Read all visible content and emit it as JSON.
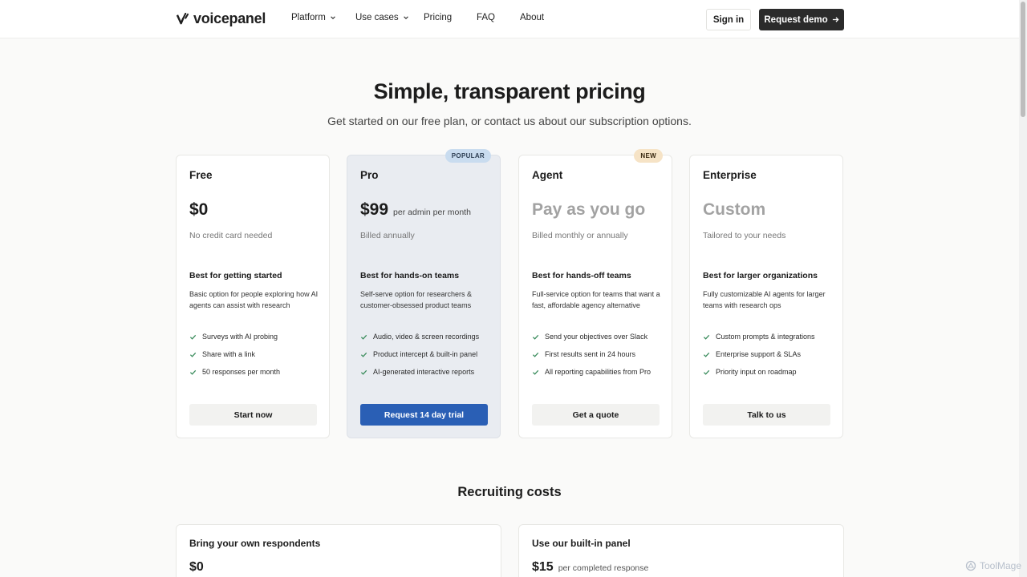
{
  "nav": {
    "logo_text": "voicepanel",
    "items": [
      {
        "label": "Platform",
        "has_dropdown": true
      },
      {
        "label": "Use cases",
        "has_dropdown": true
      },
      {
        "label": "Pricing",
        "has_dropdown": false
      },
      {
        "label": "FAQ",
        "has_dropdown": false
      },
      {
        "label": "About",
        "has_dropdown": false
      }
    ],
    "sign_in": "Sign in",
    "request_demo": "Request demo"
  },
  "hero": {
    "title": "Simple, transparent pricing",
    "subtitle": "Get started on our free plan, or contact us about our subscription options."
  },
  "plans": [
    {
      "name": "Free",
      "badge": "",
      "price": "$0",
      "price_unit": "",
      "billing": "No credit card needed",
      "best_for": "Best for getting started",
      "description": "Basic option for people exploring how AI agents can assist with research",
      "features": [
        "Surveys with AI probing",
        "Share with a link",
        "50 responses per month"
      ],
      "cta": "Start now"
    },
    {
      "name": "Pro",
      "badge": "POPULAR",
      "price": "$99",
      "price_unit": "per admin per month",
      "billing": "Billed annually",
      "best_for": "Best for hands-on teams",
      "description": "Self-serve option for researchers & customer-obsessed product teams",
      "features": [
        "Audio, video & screen recordings",
        "Product intercept & built-in panel",
        "AI-generated interactive reports"
      ],
      "cta": "Request 14 day trial"
    },
    {
      "name": "Agent",
      "badge": "NEW",
      "price": "Pay as you go",
      "price_unit": "",
      "billing": "Billed monthly or annually",
      "best_for": "Best for hands-off teams",
      "description": "Full-service option for teams that want a fast, affordable agency alternative",
      "features": [
        "Send your objectives over Slack",
        "First results sent in 24 hours",
        "All reporting capabilities from Pro"
      ],
      "cta": "Get a quote"
    },
    {
      "name": "Enterprise",
      "badge": "",
      "price": "Custom",
      "price_unit": "",
      "billing": "Tailored to your needs",
      "best_for": "Best for larger organizations",
      "description": "Fully customizable AI agents for larger teams with research ops",
      "features": [
        "Custom prompts & integrations",
        "Enterprise support & SLAs",
        "Priority input on roadmap"
      ],
      "cta": "Talk to us"
    }
  ],
  "recruiting": {
    "title": "Recruiting costs",
    "options": [
      {
        "name": "Bring your own respondents",
        "price": "$0",
        "unit": ""
      },
      {
        "name": "Use our built-in panel",
        "price": "$15",
        "unit": "per completed response"
      }
    ]
  },
  "watermark": "ToolMage",
  "colors": {
    "accent": "#2a5fb5",
    "check": "#3a8c5c",
    "pro_card_bg": "#e9ecf1",
    "popular_badge": "#c9dcef",
    "new_badge": "#f6e3c6"
  }
}
